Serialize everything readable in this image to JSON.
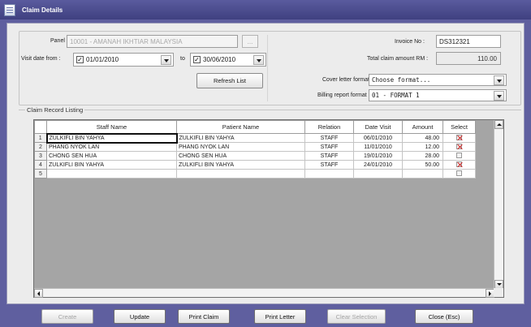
{
  "window": {
    "title": "Claim Details"
  },
  "header": {
    "panel_label": "Panel :",
    "panel_value": "10001 - AMANAH IKHTIAR MALAYSIA",
    "panel_lookup": "...",
    "visit_from_label": "Visit date from :",
    "visit_from_value": "01/01/2010",
    "to_label": "to",
    "visit_to_value": "30/06/2010",
    "refresh_label": "Refresh List",
    "invoice_label": "Invoice No :",
    "invoice_value": "DS312321",
    "total_label": "Total claim amount RM :",
    "total_value": "110.00",
    "cover_letter_label": "Cover letter format :",
    "cover_letter_value": "Choose format...",
    "billing_label": "Billing report format :",
    "billing_value": "01 - FORMAT 1"
  },
  "listing": {
    "group_title": "Claim Record Listing",
    "columns": [
      "Staff Name",
      "Patient Name",
      "Relation",
      "Date Visit",
      "Amount",
      "Select"
    ],
    "rows": [
      {
        "no": "1",
        "staff": "ZULKIFLI BIN YAHYA",
        "patient": "ZULKIFLI BIN YAHYA",
        "relation": "STAFF",
        "date": "06/01/2010",
        "amount": "48.00",
        "selected": true
      },
      {
        "no": "2",
        "staff": "PHANG NYOK LAN",
        "patient": "PHANG NYOK LAN",
        "relation": "STAFF",
        "date": "11/01/2010",
        "amount": "12.00",
        "selected": true
      },
      {
        "no": "3",
        "staff": "CHONG SEN HUA",
        "patient": "CHONG SEN HUA",
        "relation": "STAFF",
        "date": "19/01/2010",
        "amount": "28.00",
        "selected": false
      },
      {
        "no": "4",
        "staff": "ZULKIFLI BIN YAHYA",
        "patient": "ZULKIFLI BIN YAHYA",
        "relation": "STAFF",
        "date": "24/01/2010",
        "amount": "50.00",
        "selected": true
      },
      {
        "no": "5",
        "staff": "",
        "patient": "",
        "relation": "",
        "date": "",
        "amount": "",
        "selected": false
      }
    ]
  },
  "actions": {
    "create": "Create",
    "update": "Update",
    "print_claim": "Print Claim",
    "print_letter": "Print Letter",
    "clear_selection": "Clear Selection",
    "close": "Close (Esc)"
  },
  "colors": {
    "titlebar": "#4a4b8c",
    "frame": "#5f5f9f",
    "check_mark": "#d21a1a"
  },
  "icons": {
    "app": "document-icon",
    "row_select": "red-x-check-icon"
  }
}
